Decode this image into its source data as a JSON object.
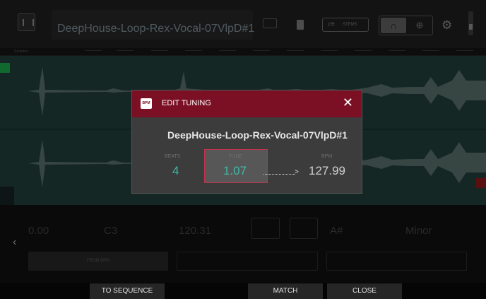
{
  "header": {
    "sample_name": "DeepHouse-Loop-Rex-Vocal-07VlpD#1",
    "stems_label": "STEMS"
  },
  "timeline": {
    "label": "Samples"
  },
  "params": {
    "tune_value": "0.00",
    "root_note_value": "C3",
    "bpm_value": "120.31",
    "key_value": "A#",
    "scale_value": "Minor",
    "from_bpm_label": "FROM BPM"
  },
  "dialog": {
    "title": "EDIT TUNING",
    "badge": "BPM",
    "sample_name": "DeepHouse-Loop-Rex-Vocal-07VlpD#1",
    "beats_label": "BEATS",
    "beats_value": "4",
    "tune_label": "TUNE",
    "tune_value": "1.07",
    "bpm_label": "BPM",
    "bpm_value": "127.99"
  },
  "bottom_bar": {
    "to_sequence": "TO SEQUENCE",
    "match": "MATCH",
    "close": "CLOSE"
  },
  "colors": {
    "header_red": "#7b1024",
    "accent_teal": "#3fb8a8",
    "waveform_bg": "#1f3d3a",
    "tune_outline": "#c0354d"
  },
  "icons": {
    "close": "close-icon",
    "back": "chevron-left-icon",
    "trash": "trash-icon",
    "headphones": "headphones-icon",
    "zoom": "zoom-icon",
    "settings": "gear-icon"
  }
}
